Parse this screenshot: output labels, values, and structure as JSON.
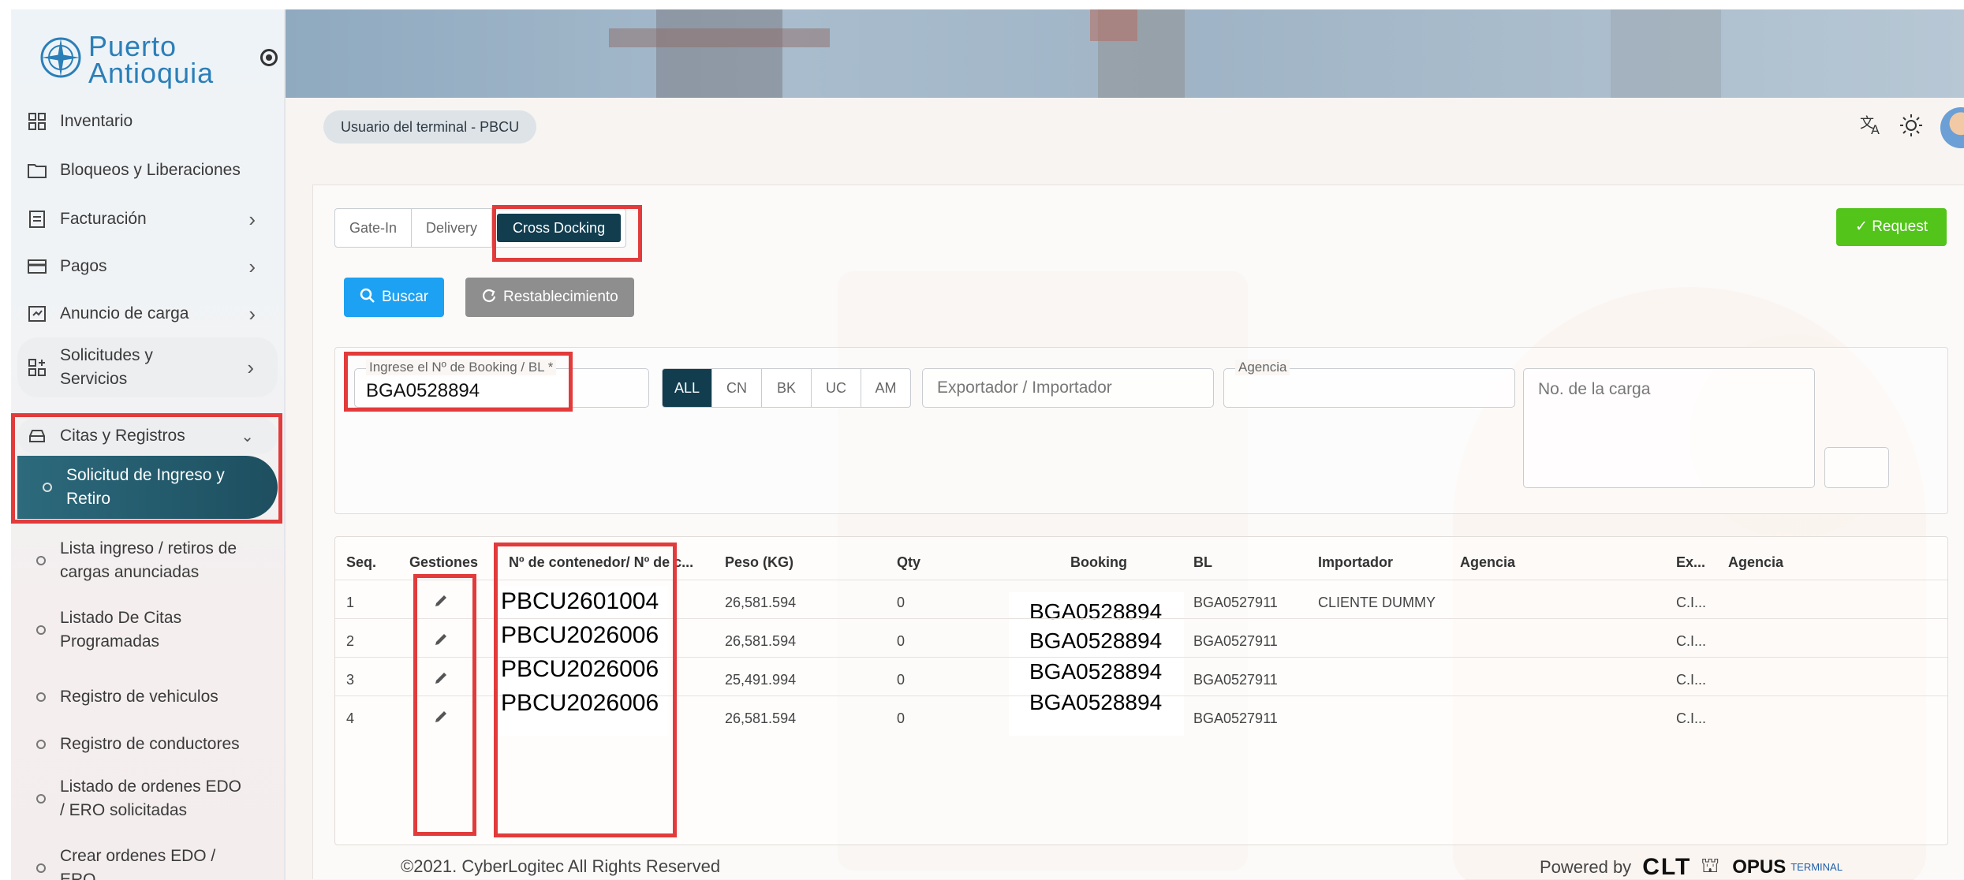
{
  "brand": {
    "name_line1": "Puerto",
    "name_line2": "Antioquia"
  },
  "sidebar": {
    "items": [
      {
        "label": "Inventario",
        "icon": "grid-icon"
      },
      {
        "label": "Bloqueos y Liberaciones",
        "icon": "folder-icon"
      },
      {
        "label": "Facturación",
        "icon": "invoice-icon"
      },
      {
        "label": "Pagos",
        "icon": "card-icon"
      },
      {
        "label": "Anuncio de carga",
        "icon": "announce-icon"
      },
      {
        "label_line1": "Solicitudes y",
        "label_line2": "Servicios",
        "icon": "apps-icon"
      },
      {
        "label": "Citas y Registros",
        "icon": "car-icon"
      }
    ],
    "subitems": [
      {
        "line1": "Solicitud de Ingreso y",
        "line2": "Retiro"
      },
      {
        "line1": "Lista ingreso / retiros de",
        "line2": "cargas anunciadas"
      },
      {
        "line1": "Listado De Citas",
        "line2": "Programadas"
      },
      {
        "line1": "Registro de vehiculos",
        "line2": ""
      },
      {
        "line1": "Registro de conductores",
        "line2": ""
      },
      {
        "line1": "Listado de ordenes EDO",
        "line2": "/ ERO solicitadas"
      },
      {
        "line1": "Crear ordenes EDO /",
        "line2": "ERO"
      }
    ]
  },
  "header": {
    "user_chip": "Usuario del terminal - PBCU",
    "icons": [
      "translate-icon",
      "sun-icon",
      "avatar"
    ]
  },
  "tabs": [
    "Gate-In",
    "Delivery",
    "Cross Docking"
  ],
  "actions": {
    "request": "Request",
    "search": "Buscar",
    "reset": "Restablecimiento"
  },
  "filters": {
    "booking_label": "Ingrese el Nº de Booking / BL *",
    "booking_value": "BGA0528894",
    "segments": [
      "ALL",
      "CN",
      "BK",
      "UC",
      "AM"
    ],
    "exporter_placeholder": "Exportador / Importador",
    "agency_label": "Agencia",
    "cargo_placeholder": "No. de la carga"
  },
  "table": {
    "headers": [
      "Seq.",
      "Gestiones",
      "Nº de contenedor/ Nº de c...",
      "Peso (KG)",
      "Qty",
      "Booking",
      "BL",
      "Importador",
      "Agencia",
      "Ex...",
      "Agencia"
    ],
    "rows": [
      {
        "seq": "1",
        "container": "PBCU2601004",
        "peso": "26,581.594",
        "qty": "0",
        "booking": "BGA0528894",
        "bl": "BGA0527911",
        "importador": "CLIENTE DUMMY",
        "ex": "C.I..."
      },
      {
        "seq": "2",
        "container": "PBCU2026006",
        "peso": "26,581.594",
        "qty": "0",
        "booking": "BGA0528894",
        "bl": "BGA0527911",
        "importador": "",
        "ex": "C.I..."
      },
      {
        "seq": "3",
        "container": "PBCU2026006",
        "peso": "25,491.994",
        "qty": "0",
        "booking": "BGA0528894",
        "bl": "BGA0527911",
        "importador": "",
        "ex": "C.I..."
      },
      {
        "seq": "4",
        "container": "PBCU2026006",
        "peso": "26,581.594",
        "qty": "0",
        "booking": "BGA0528894",
        "bl": "BGA0527911",
        "importador": "",
        "ex": "C.I..."
      }
    ]
  },
  "footer": {
    "copyright": "©2021. CyberLogitec All Rights Reserved",
    "powered": "Powered by",
    "clt": "CLT",
    "opus": "OPUS",
    "terminal": "TERMINAL"
  },
  "colors": {
    "accent_dark": "#113d4f",
    "request_green": "#52c41a",
    "search_blue": "#1da1f2",
    "annotation_red": "#e23b3b"
  }
}
